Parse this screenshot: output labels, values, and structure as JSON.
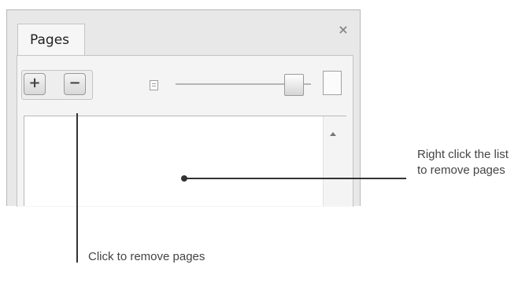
{
  "panel": {
    "tab_label": "Pages",
    "close_label": "×",
    "toolbar": {
      "add_label": "+",
      "remove_label": "−"
    }
  },
  "annotations": {
    "right": "Right click the list to remove pages",
    "bottom": "Click to remove pages"
  },
  "icons": {
    "small_page": "small-page-icon",
    "large_page": "large-page-icon",
    "close": "close-icon",
    "scroll_up": "scroll-up-icon"
  },
  "colors": {
    "panel_bg": "#e8e8e8",
    "border": "#b8b8b8",
    "annotation_text": "#444444",
    "callout": "#333333"
  }
}
